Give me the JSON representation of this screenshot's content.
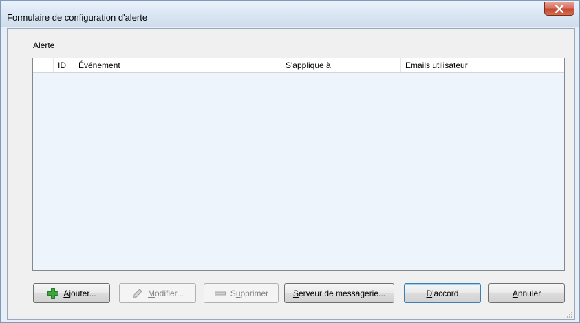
{
  "window": {
    "title": "Formulaire de configuration d'alerte",
    "close_label": "X"
  },
  "group": {
    "label": "Alerte"
  },
  "grid": {
    "columns": [
      "",
      "ID",
      "Événement",
      "S'applique à",
      "Emails utilisateur"
    ],
    "rows": []
  },
  "buttons": {
    "add": {
      "mnemonic": "A",
      "rest": "jouter...",
      "enabled": true,
      "icon": "plus-icon"
    },
    "edit": {
      "mnemonic": "M",
      "rest": "odifier...",
      "enabled": false,
      "icon": "pencil-icon"
    },
    "delete": {
      "prefix": "S",
      "mnemonic": "u",
      "rest": "pprimer",
      "enabled": false,
      "icon": "minus-icon"
    },
    "mailserver": {
      "mnemonic": "S",
      "rest": "erveur de messagerie...",
      "enabled": true
    },
    "ok": {
      "mnemonic": "D",
      "rest": "'accord",
      "enabled": true,
      "default": true
    },
    "cancel": {
      "mnemonic": "A",
      "rest": "nnuler",
      "enabled": true
    }
  },
  "colors": {
    "accent_plus": "#3aa83a",
    "close_button": "#c24a34",
    "grid_background": "#eef4fb"
  }
}
